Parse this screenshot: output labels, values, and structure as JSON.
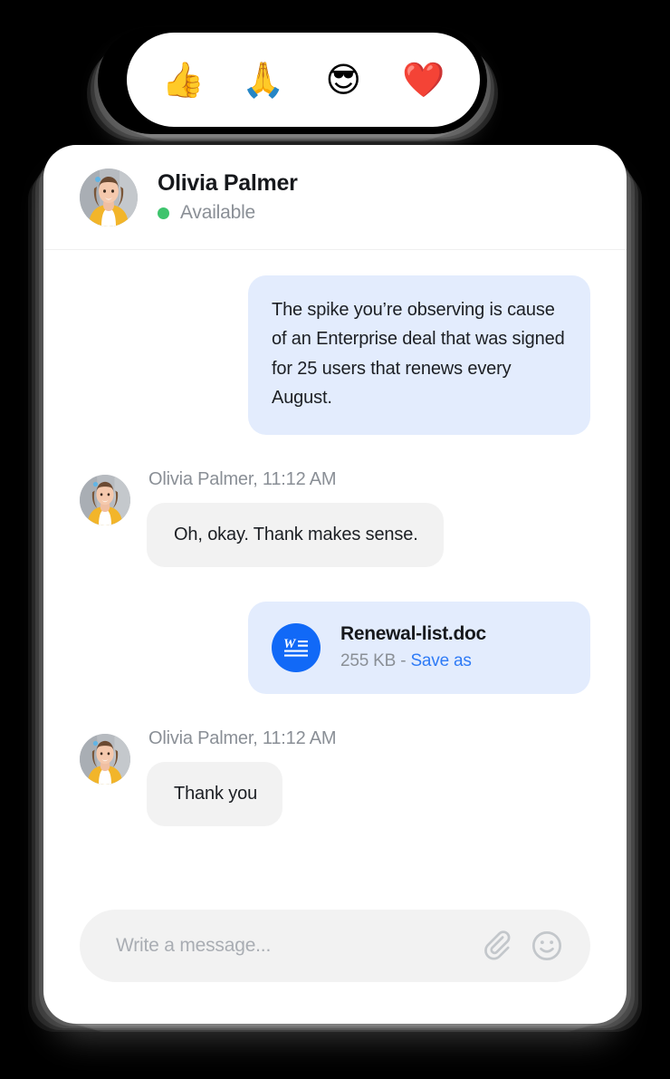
{
  "theme": {
    "background": "#000000",
    "card_bg": "#ffffff",
    "outgoing_bubble": "#e3ecfd",
    "incoming_bubble": "#f2f2f2",
    "accent_blue": "#1169f7",
    "link_blue": "#2f7bf6",
    "status_green": "#3ec46d",
    "muted_text": "#8a8f96",
    "primary_text": "#16181c"
  },
  "emoji_bar": {
    "name": "quick-reactions",
    "items": [
      {
        "name": "thumbs-up",
        "glyph": "👍"
      },
      {
        "name": "folded-hands",
        "glyph": "🙏"
      },
      {
        "name": "smiling-face-with-sunglasses",
        "glyph": "😎"
      },
      {
        "name": "red-heart",
        "glyph": "❤️"
      }
    ]
  },
  "header": {
    "contact_name": "Olivia Palmer",
    "status_label": "Available",
    "avatar_name": "olivia-palmer-avatar"
  },
  "messages": [
    {
      "id": "msg-1",
      "direction": "outgoing",
      "text": "The spike you’re observing is cause of an Enterprise deal that was signed for 25 users that renews every August."
    },
    {
      "id": "msg-2",
      "direction": "incoming",
      "meta": "Olivia Palmer, 11:12 AM",
      "text": "Oh, okay. Thank makes sense."
    },
    {
      "id": "msg-3",
      "direction": "outgoing",
      "type": "file",
      "file_name": "Renewal-list.doc",
      "file_size": "255 KB",
      "separator": " - ",
      "action_label": "Save as",
      "icon_name": "word-document-icon"
    },
    {
      "id": "msg-4",
      "direction": "incoming",
      "meta": "Olivia Palmer, 11:12 AM",
      "text": "Thank you"
    }
  ],
  "composer": {
    "placeholder": "Write a message...",
    "value": "",
    "attach_icon": "paperclip-icon",
    "emoji_icon": "smiley-face-icon"
  }
}
